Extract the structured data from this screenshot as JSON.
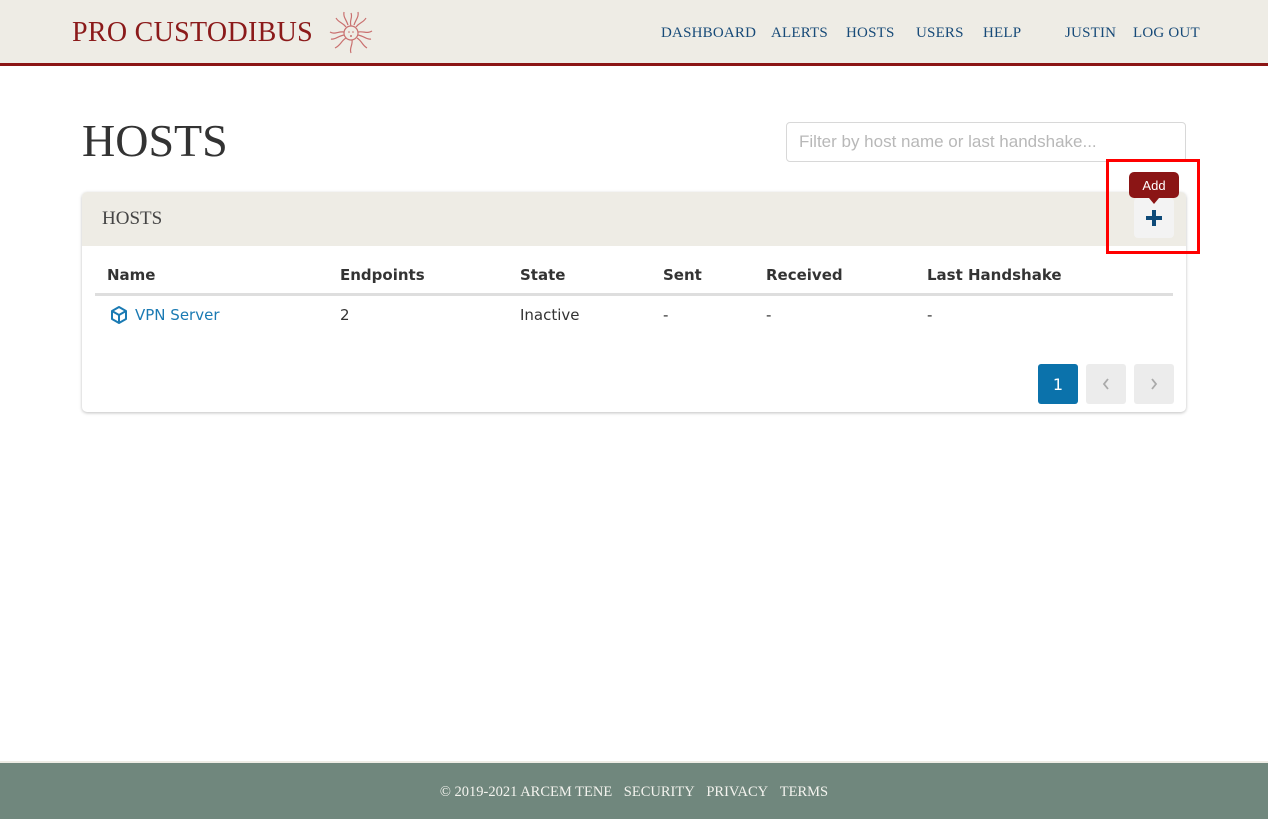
{
  "header": {
    "brand": "PRO CUSTODIBUS",
    "logo_icon": "medusa-head-icon",
    "nav": [
      {
        "label": "DASHBOARD"
      },
      {
        "label": "ALERTS"
      },
      {
        "label": "HOSTS"
      },
      {
        "label": "USERS"
      },
      {
        "label": "HELP"
      }
    ],
    "user": "JUSTIN",
    "logout": "LOG OUT"
  },
  "main": {
    "title": "HOSTS",
    "filter": {
      "placeholder": "Filter by host name or last handshake...",
      "value": ""
    },
    "card": {
      "title": "HOSTS",
      "add_tooltip": "Add",
      "add_icon": "plus-icon",
      "columns": [
        "Name",
        "Endpoints",
        "State",
        "Sent",
        "Received",
        "Last Handshake"
      ],
      "rows": [
        {
          "icon": "cube-icon",
          "name": "VPN Server",
          "endpoints": "2",
          "state": "Inactive",
          "sent": "-",
          "received": "-",
          "last_handshake": "-"
        }
      ],
      "pagination": {
        "current": "1",
        "prev": "‹",
        "next": "›"
      }
    }
  },
  "footer": {
    "copyright": "© 2019-2021 ARCEM TENE",
    "links": [
      "SECURITY",
      "PRIVACY",
      "TERMS"
    ]
  },
  "colors": {
    "brand": "#8b1a1a",
    "nav": "#174a78",
    "link": "#1a7ab3",
    "page_active": "#0b72ab",
    "footer_bg": "#70877d",
    "header_bg": "#eeece5",
    "highlight": "#ff0000"
  }
}
